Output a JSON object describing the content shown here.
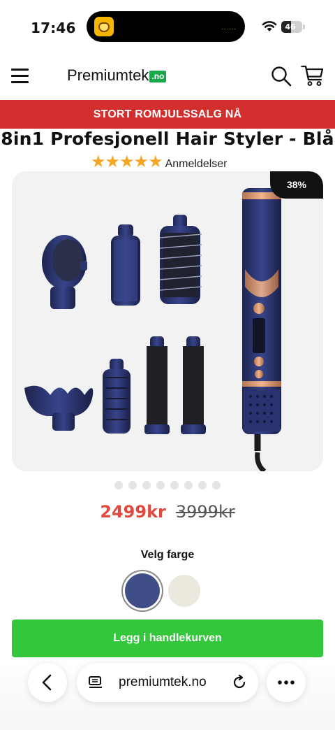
{
  "status_bar": {
    "time": "17:46",
    "battery": "46",
    "battery_level": 0.46,
    "island_dots": "......"
  },
  "header": {
    "logo_text": "Premiumtek",
    "logo_suffix": ".no"
  },
  "promo": {
    "text": "STORT ROMJULSSALG NÅ",
    "color": "#d32f2f"
  },
  "product": {
    "title": "8in1 Profesjonell Hair Styler - Blå",
    "stars": "★★★★★",
    "rating_value": 5,
    "rating_label": "Anmeldelser",
    "discount": "38%",
    "image_count": 8,
    "price": "2499kr",
    "old_price": "3999kr",
    "color_label": "Velg farge",
    "colors": [
      "#3f4e86",
      "#ebe8dd"
    ],
    "add_to_cart": "Legg i handlekurven",
    "cta_color": "#34c73b"
  },
  "browser": {
    "url": "premiumtek.no"
  },
  "icons": [
    "menu-icon",
    "search-icon",
    "cart-icon",
    "wifi-icon",
    "battery-icon",
    "back-icon",
    "reader-icon",
    "reload-icon",
    "more-icon"
  ]
}
